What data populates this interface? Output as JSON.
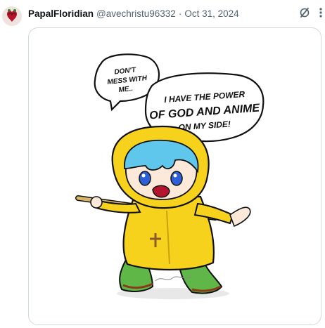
{
  "post": {
    "display_name": "PapalFloridian",
    "handle": "@avechristu96332",
    "separator": "·",
    "date": "Oct 31, 2024"
  },
  "icons": {
    "grok": "grok-icon",
    "more": "more-icon",
    "avatar": "avatar-image"
  },
  "media": {
    "speech_small": [
      "DON'T",
      "MESS WITH",
      "ME.."
    ],
    "speech_big": [
      "I HAVE THE POWER",
      "OF GOD AND ANIME",
      "ON MY SIDE!"
    ],
    "signature": "signature"
  },
  "colors": {
    "raincoat": "#f6d21d",
    "hair": "#5fc7ec",
    "boots": "#5fb748",
    "border": "#cfd9de"
  }
}
